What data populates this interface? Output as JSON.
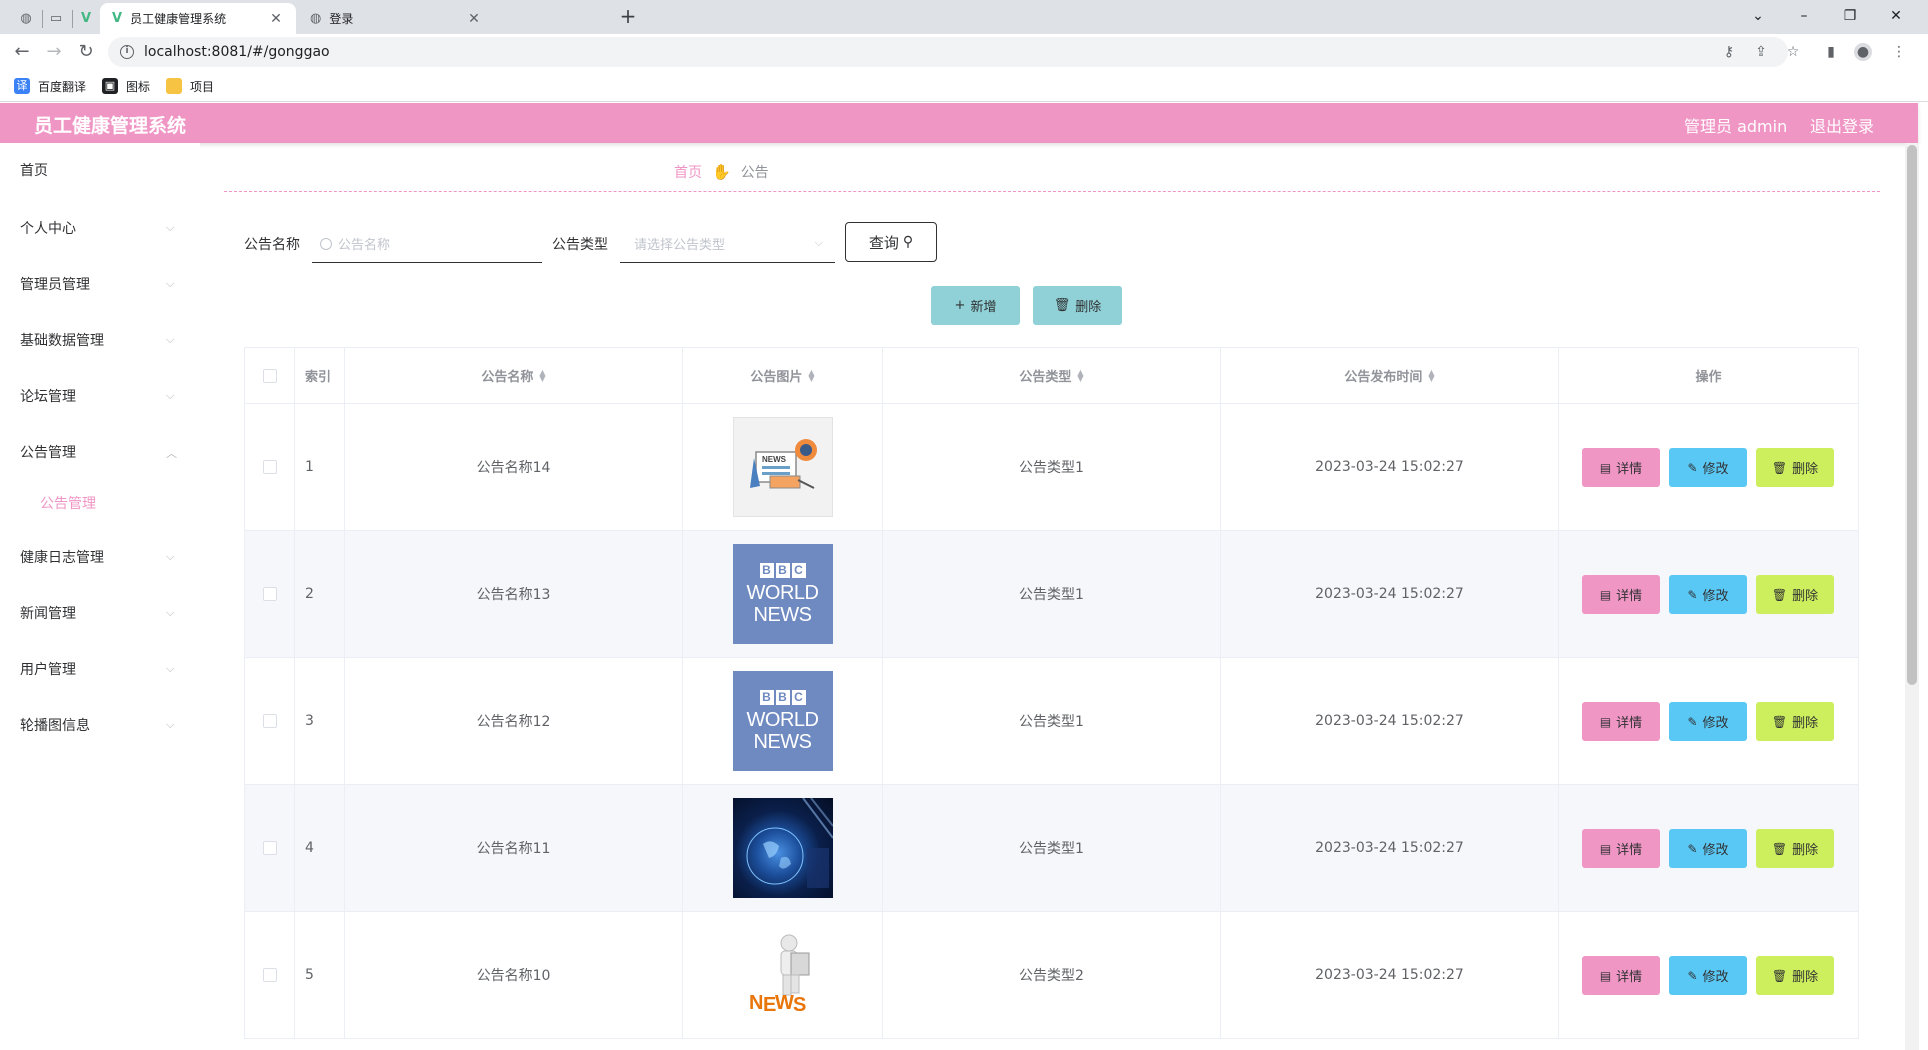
{
  "browser": {
    "tabs": [
      {
        "title": "员工健康管理系统",
        "active": true
      },
      {
        "title": "登录",
        "active": false
      }
    ],
    "url": "localhost:8081/#/gonggao",
    "bookmarks": [
      {
        "label": "百度翻译",
        "icon": "translate-icon"
      },
      {
        "label": "图标",
        "icon": "image-icon"
      },
      {
        "label": "项目",
        "icon": "folder-icon"
      }
    ]
  },
  "header": {
    "title": "员工健康管理系统",
    "user": "管理员 admin",
    "logout": "退出登录",
    "color": "#f096c5"
  },
  "sidebar": {
    "items": [
      {
        "label": "首页",
        "expandable": false
      },
      {
        "label": "个人中心",
        "expandable": true
      },
      {
        "label": "管理员管理",
        "expandable": true
      },
      {
        "label": "基础数据管理",
        "expandable": true
      },
      {
        "label": "论坛管理",
        "expandable": true
      },
      {
        "label": "公告管理",
        "expandable": true,
        "expanded": true
      },
      {
        "label": "健康日志管理",
        "expandable": true
      },
      {
        "label": "新闻管理",
        "expandable": true
      },
      {
        "label": "用户管理",
        "expandable": true
      },
      {
        "label": "轮播图信息",
        "expandable": true
      }
    ],
    "subitem": "公告管理"
  },
  "breadcrumb": {
    "home": "首页",
    "current": "公告"
  },
  "search": {
    "name_label": "公告名称",
    "name_placeholder": "公告名称",
    "type_label": "公告类型",
    "type_placeholder": "请选择公告类型",
    "query_button": "查询"
  },
  "actions": {
    "add": "新增",
    "delete": "删除"
  },
  "table": {
    "headers": {
      "index": "索引",
      "name": "公告名称",
      "image": "公告图片",
      "type": "公告类型",
      "time": "公告发布时间",
      "ops": "操作"
    },
    "op_labels": {
      "detail": "详情",
      "edit": "修改",
      "delete": "删除"
    },
    "rows": [
      {
        "index": "1",
        "name": "公告名称14",
        "image": "news-paper-image",
        "type": "公告类型1",
        "time": "2023-03-24 15:02:27"
      },
      {
        "index": "2",
        "name": "公告名称13",
        "image": "bbc-world-news-image",
        "type": "公告类型1",
        "time": "2023-03-24 15:02:27"
      },
      {
        "index": "3",
        "name": "公告名称12",
        "image": "bbc-world-news-image",
        "type": "公告类型1",
        "time": "2023-03-24 15:02:27"
      },
      {
        "index": "4",
        "name": "公告名称11",
        "image": "globe-news-image",
        "type": "公告类型1",
        "time": "2023-03-24 15:02:27"
      },
      {
        "index": "5",
        "name": "公告名称10",
        "image": "news-figure-image",
        "type": "公告类型2",
        "time": "2023-03-24 15:02:27"
      }
    ]
  },
  "bbc": {
    "b1": "B",
    "b2": "B",
    "b3": "C",
    "world": "WORLD",
    "news": "NEWS"
  },
  "colors": {
    "detail": "#f096c5",
    "edit": "#5ac8f5",
    "delete": "#cdef5e",
    "add": "#8fd1d6"
  }
}
